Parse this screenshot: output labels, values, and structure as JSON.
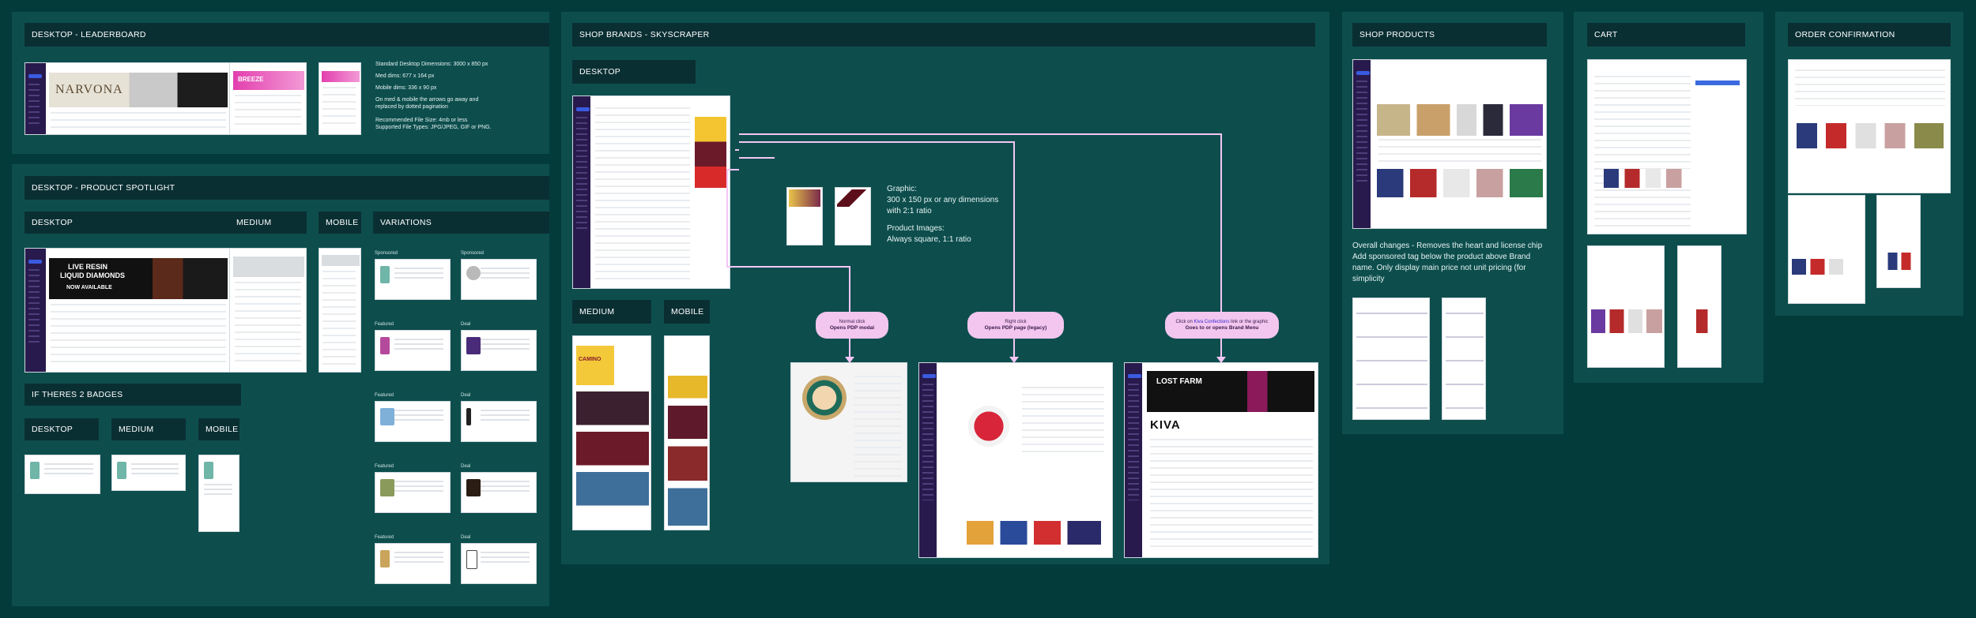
{
  "sections": {
    "leaderboard": "DESKTOP - LEADERBOARD",
    "product_spotlight": "DESKTOP - PRODUCT SPOTLIGHT",
    "shop_brands": "SHOP BRANDS - SKYSCRAPER",
    "shop_products": "SHOP PRODUCTS",
    "cart": "CART",
    "order_confirmation": "ORDER CONFIRMATION"
  },
  "subheaders": {
    "desktop": "DESKTOP",
    "medium": "MEDIUM",
    "mobile": "MOBILE",
    "variations": "VARIATIONS",
    "two_badges": "IF THERES 2 BADGES",
    "desktop2": "DESKTOP",
    "medium2": "MEDIUM",
    "mobile2": "MOBILE",
    "sky_desktop": "DESKTOP",
    "sky_medium": "MEDIUM",
    "sky_mobile": "MOBILE"
  },
  "leaderboard_notes": {
    "line1": "Standard Desktop Dimensions: 3000 x 850 px",
    "line2": "Med dims: 677 x 164 px",
    "line3": "Mobile dims: 336 x 90 px",
    "line4a": "On med & mobile the arrows go away and",
    "line4b": "replaced by dotted pagination",
    "line5": "Recommended File Size: 4mb or less",
    "line6": "Supported File Types: JPG/JPEG, GIF or PNG."
  },
  "variations": {
    "left": [
      "Sponsored",
      "Featured",
      "Featured",
      "Featured",
      "Featured"
    ],
    "right": [
      "Sponsored",
      "Deal",
      "Deal",
      "Deal",
      "Deal"
    ]
  },
  "graphic_notes": {
    "g1": "Graphic:",
    "g2": "300 x 150 px or any dimensions",
    "g3": "with 2:1 ratio",
    "p1": "Product Images:",
    "p2": "Always square, 1:1 ratio"
  },
  "pills": {
    "p1_top": "Normal click",
    "p1_bottom": "Opens PDP modal",
    "p2_top": "Right click",
    "p2_bottom": "Opens PDP page (legacy)",
    "p3_top_a": "Click on ",
    "p3_top_b": "Kiva Confections",
    "p3_top_c": " link or the graphic",
    "p3_bottom": "Goes to or opens Brand Menu"
  },
  "shop_products_note": {
    "l1": "Overall changes - Removes the heart and license chip",
    "l2": "Add sponsored tag below the product above Brand",
    "l3": "name. Only display main price not unit pricing (for",
    "l4": "simplicity"
  },
  "banners": {
    "narvona": "NARVONA",
    "breeze": "BREEZE",
    "live_resin_1": "LIVE RESIN",
    "live_resin_2": "LIQUID DIAMONDS",
    "now_available": "NOW AVAILABLE",
    "camino": "CAMINO",
    "lost_farm": "LOST FARM",
    "kiva": "KIVA"
  },
  "colors": {
    "background": "#033b3b",
    "panel": "#0d4e4d",
    "header": "#0a2f33",
    "nav": "#281a4d",
    "pill": "#f2c6ef",
    "connector": "#f4c6f4"
  }
}
